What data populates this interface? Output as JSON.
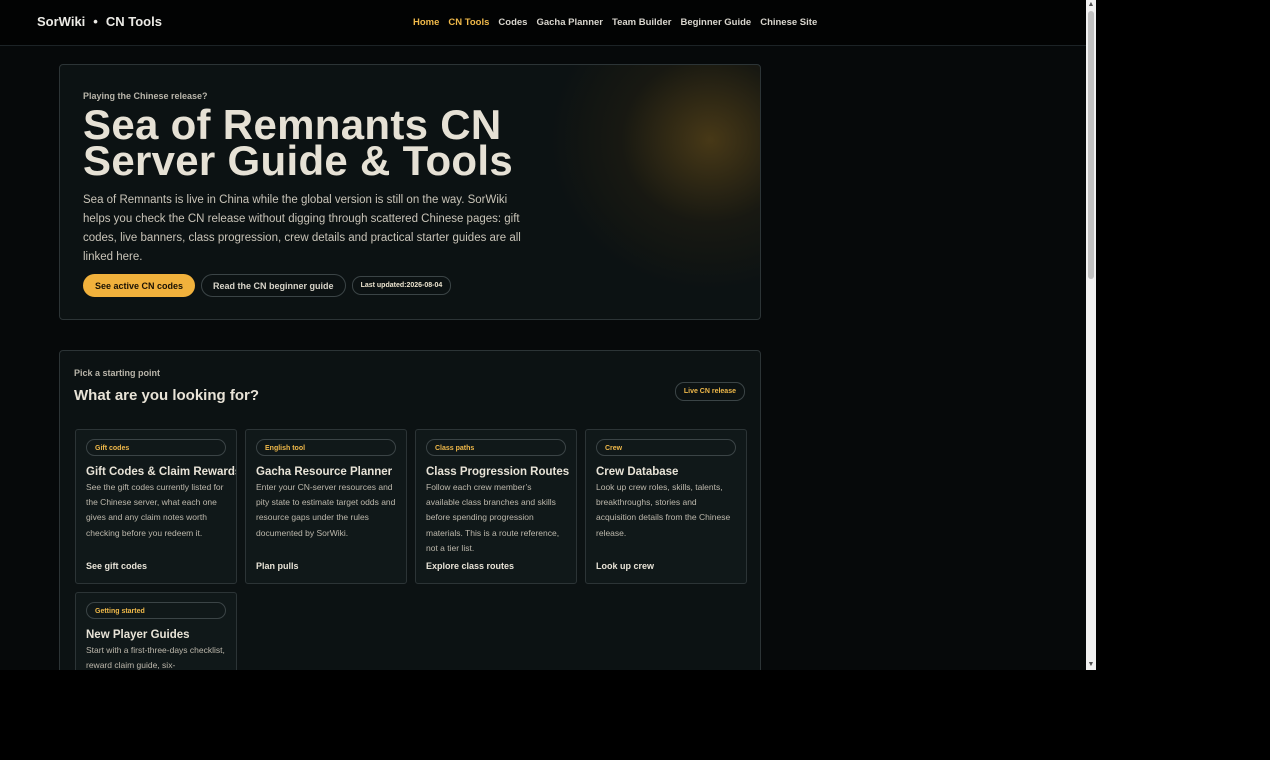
{
  "header": {
    "brand": "SorWiki",
    "separator": "•",
    "section": "CN Tools",
    "nav": [
      {
        "label": "Home",
        "active": false
      },
      {
        "label": "CN Tools",
        "active": true
      },
      {
        "label": "Codes",
        "active": false
      },
      {
        "label": "Gacha Planner",
        "active": false
      },
      {
        "label": "Team Builder",
        "active": false
      },
      {
        "label": "Beginner Guide",
        "active": false
      },
      {
        "label": "Chinese Site",
        "active": false
      }
    ]
  },
  "hero": {
    "eyebrow": "Playing the Chinese release?",
    "title": "Sea of Remnants CN Server Guide & Tools",
    "description": "Sea of Remnants is live in China while the global version is still on the way. SorWiki helps you check the CN release without digging through scattered Chinese pages: gift codes, live banners, class progression, crew details and practical starter guides are all linked here.",
    "primary_button": "See active CN codes",
    "secondary_button": "Read the CN beginner guide",
    "updated_label": "Last updated:",
    "updated_date": "2026-08-04"
  },
  "picker": {
    "eyebrow": "Pick a starting point",
    "title": "What are you looking for?",
    "badge": "Live CN release",
    "cards": [
      {
        "tag": "Gift codes",
        "title": "Gift Codes & Claim Rewards",
        "description": "See the gift codes currently listed for the Chinese server, what each one gives and any claim notes worth checking before you redeem it.",
        "link": "See gift codes"
      },
      {
        "tag": "English tool",
        "title": "Gacha Resource Planner",
        "description": "Enter your CN-server resources and pity state to estimate target odds and resource gaps under the rules documented by SorWiki.",
        "link": "Plan pulls"
      },
      {
        "tag": "Class paths",
        "title": "Class Progression Routes",
        "description": "Follow each crew member’s available class branches and skills before spending progression materials. This is a route reference, not a tier list.",
        "link": "Explore class routes"
      },
      {
        "tag": "Crew",
        "title": "Crew Database",
        "description": "Look up crew roles, skills, talents, breakthroughs, stories and acquisition details from the Chinese release.",
        "link": "Look up crew"
      },
      {
        "tag": "Getting started",
        "title": "New Player Guides",
        "description": "Start with a first-three-days checklist, reward claim guide, six-",
        "link": ""
      }
    ]
  },
  "colors": {
    "accent": "#f1b13c",
    "active_nav": "#f0b94a",
    "background": "#06090a",
    "panel": "#0c1213"
  }
}
